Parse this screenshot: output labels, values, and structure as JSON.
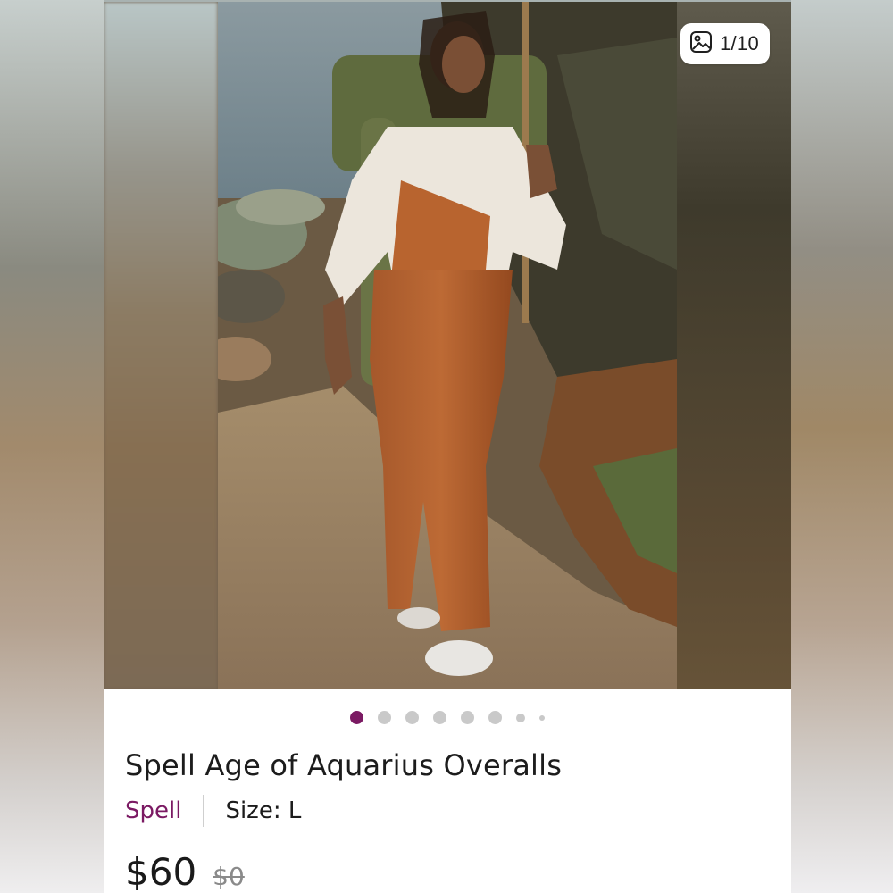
{
  "listing": {
    "image_counter": "1/10",
    "title": "Spell Age of Aquarius Overalls",
    "brand": "Spell",
    "size_text": "Size: L",
    "price": "$60",
    "original_price": "$0"
  },
  "carousel": {
    "total_dots": 8,
    "active_index": 0
  },
  "colors": {
    "accent": "#7b1a63",
    "text": "#1c1c1c",
    "muted": "#8a8a8a"
  },
  "icons": {
    "counter": "image-gallery-icon"
  }
}
